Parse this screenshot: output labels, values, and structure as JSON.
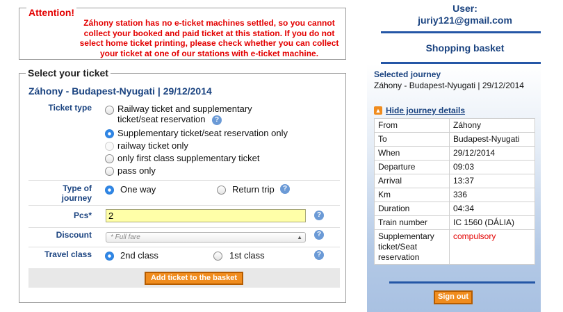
{
  "attention": {
    "title": "Attention!",
    "message": "Záhony station has no e-ticket machines settled, so you cannot collect your booked and paid ticket at this station. If you do not select home ticket printing, please check whether you can collect your ticket at one of our stations with e-ticket machine."
  },
  "ticket_form": {
    "legend": "Select your ticket",
    "journey": "Záhony - Budapest-Nyugati | 29/12/2014",
    "ticket_type": {
      "label": "Ticket type",
      "options": [
        "Railway ticket and supplementary ticket/seat reservation",
        "Supplementary ticket/seat reservation only",
        "railway ticket only",
        "only first class supplementary ticket",
        "pass only"
      ],
      "selected_index": 1
    },
    "journey_type": {
      "label": "Type of journey",
      "options": [
        "One way",
        "Return trip"
      ],
      "selected_index": 0
    },
    "pcs": {
      "label": "Pcs*",
      "value": "2"
    },
    "discount": {
      "label": "Discount",
      "value": "* Full fare"
    },
    "travel_class": {
      "label": "Travel class",
      "options": [
        "2nd class",
        "1st class"
      ],
      "selected_index": 0
    },
    "add_button": "Add ticket to the basket",
    "help_icon": "?"
  },
  "sidebar": {
    "user_label": "User:",
    "user_email": "juriy121@gmail.com",
    "basket_title": "Shopping basket",
    "selected_journey_heading": "Selected journey",
    "selected_journey": "Záhony - Budapest-Nyugati | 29/12/2014",
    "hide_details_link": "Hide journey details",
    "details": [
      {
        "key": "From",
        "value": "Záhony"
      },
      {
        "key": "To",
        "value": "Budapest-Nyugati"
      },
      {
        "key": "When",
        "value": "29/12/2014"
      },
      {
        "key": "Departure",
        "value": "09:03"
      },
      {
        "key": "Arrival",
        "value": "13:37"
      },
      {
        "key": "Km",
        "value": "336"
      },
      {
        "key": "Duration",
        "value": "04:34"
      },
      {
        "key": "Train number",
        "value": "IC 1560 (DÁLIA)"
      },
      {
        "key": "Supplementary ticket/Seat reservation",
        "value": "compulsory"
      }
    ],
    "sign_out": "Sign out"
  },
  "colors": {
    "accent": "#1a4380",
    "warning": "#e30000",
    "button": "#f08c1e",
    "input_highlight": "#ffffa8"
  }
}
